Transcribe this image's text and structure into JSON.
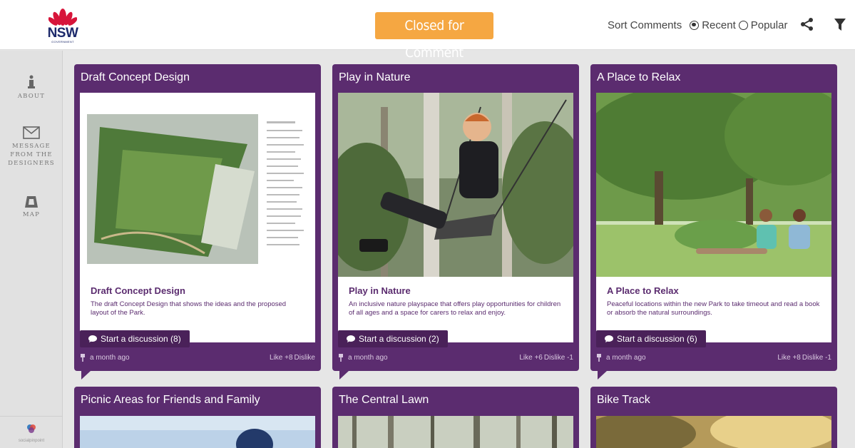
{
  "header": {
    "logo_text": "NSW",
    "logo_sub": "GOVERNMENT",
    "status": "Closed for Comment",
    "sort_label": "Sort Comments",
    "sort_options": [
      {
        "label": "Recent",
        "checked": true
      },
      {
        "label": "Popular",
        "checked": false
      }
    ],
    "icons": {
      "share": "share-icon",
      "filter": "filter-icon"
    }
  },
  "sidebar": {
    "items": [
      {
        "label": "ABOUT",
        "icon": "info-icon"
      },
      {
        "label": "MESSAGE FROM THE DESIGNERS",
        "icon": "envelope-icon"
      },
      {
        "label": "MAP",
        "icon": "map-icon"
      }
    ],
    "footer_text": "socialpinpoint"
  },
  "colors": {
    "accent": "#5b2c6f",
    "badge": "#f5a742"
  },
  "cards": [
    {
      "title": "Draft Concept Design",
      "body_title": "Draft Concept Design",
      "body_desc": "The draft Concept Design that shows the ideas and the proposed layout of the Park.",
      "discuss": "Start a discussion (8)",
      "time": "a month ago",
      "likes": "Like +8",
      "dislikes": "Dislike"
    },
    {
      "title": "Play in Nature",
      "body_title": "Play in Nature",
      "body_desc": "An inclusive nature playspace that offers play opportunities for children of all ages and a space for carers to relax and enjoy.",
      "discuss": "Start a discussion (2)",
      "time": "a month ago",
      "likes": "Like +6",
      "dislikes": "Dislike -1"
    },
    {
      "title": "A Place to Relax",
      "body_title": "A Place to Relax",
      "body_desc": "Peaceful locations within the new Park to take timeout and read a book or absorb the natural surroundings.",
      "discuss": "Start a discussion (6)",
      "time": "a month ago",
      "likes": "Like +8",
      "dislikes": "Dislike -1"
    },
    {
      "title": "Picnic Areas for Friends and Family"
    },
    {
      "title": "The Central Lawn"
    },
    {
      "title": "Bike Track"
    }
  ]
}
